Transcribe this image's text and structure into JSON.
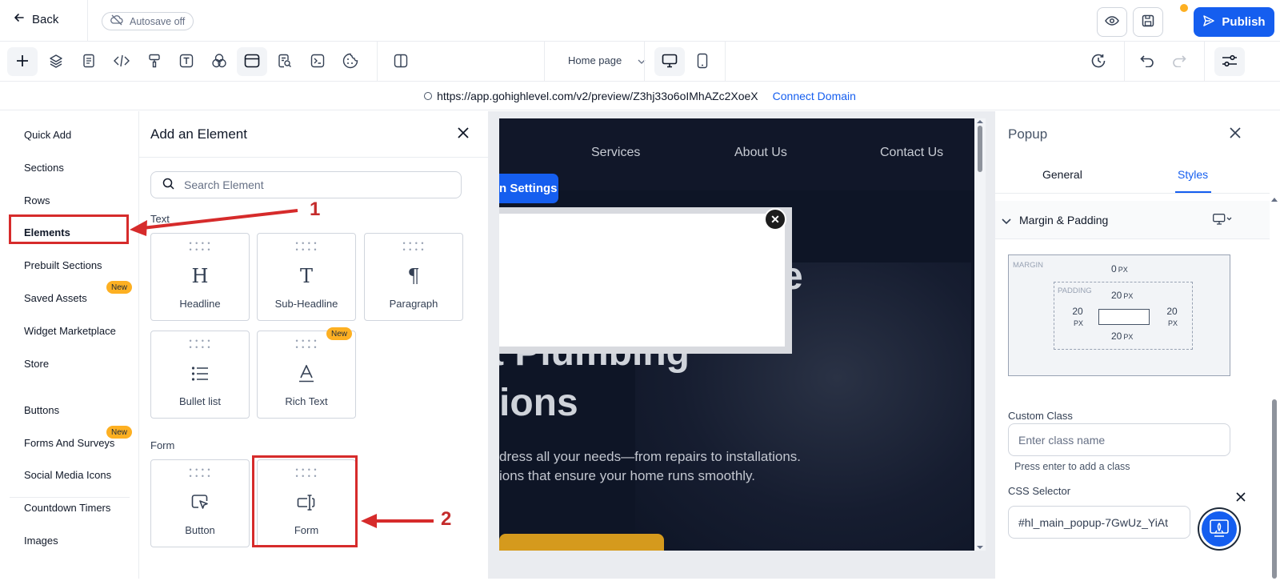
{
  "topbar": {
    "back_label": "Back",
    "autosave_label": "Autosave off",
    "publish_label": "Publish"
  },
  "toolbar": {
    "page_select": "Home page"
  },
  "urlbar": {
    "url": "https://app.gohighlevel.com/v2/preview/Z3hj33o6oIMhAZc2XoeX",
    "connect_label": "Connect Domain"
  },
  "leftnav": {
    "items": [
      "Quick Add",
      "Sections",
      "Rows",
      "Elements",
      "Prebuilt Sections",
      "Saved Assets",
      "Widget Marketplace",
      "Store",
      "Buttons",
      "Forms And Surveys",
      "Social Media Icons",
      "Countdown Timers",
      "Images"
    ],
    "new_badge": "New"
  },
  "elements_panel": {
    "title": "Add an Element",
    "search_placeholder": "Search Element",
    "text_section": "Text",
    "form_section": "Form",
    "cards": [
      "Headline",
      "Sub-Headline",
      "Paragraph",
      "Bullet list",
      "Rich Text",
      "Button",
      "Form"
    ],
    "new_badge": "New"
  },
  "canvas": {
    "nav": [
      "Services",
      "About Us",
      "Contact Us"
    ],
    "settings_label": "n Settings",
    "title_line1": "e",
    "title_line2": "t Plumbing",
    "title_line3": "ions",
    "sub_line1": "dress all your needs—from repairs to installations.",
    "sub_line2": "ions that ensure your home runs smoothly."
  },
  "right_panel": {
    "title": "Popup",
    "tab_general": "General",
    "tab_styles": "Styles",
    "section_title": "Margin & Padding",
    "margin_label": "MARGIN",
    "padding_label": "PADDING",
    "margin_top": "0",
    "pad_top": "20",
    "pad_left": "20",
    "pad_right": "20",
    "pad_bottom": "20",
    "unit": "PX",
    "custom_class_label": "Custom Class",
    "custom_class_placeholder": "Enter class name",
    "custom_class_hint": "Press enter to add a class",
    "css_selector_label": "CSS Selector",
    "css_selector_value": "#hl_main_popup-7GwUz_YiAt"
  },
  "annotations": {
    "step1": "1",
    "step2": "2"
  },
  "colors": {
    "accent": "#155eef",
    "badge": "#fdb022",
    "annotation": "#d62b2b"
  }
}
